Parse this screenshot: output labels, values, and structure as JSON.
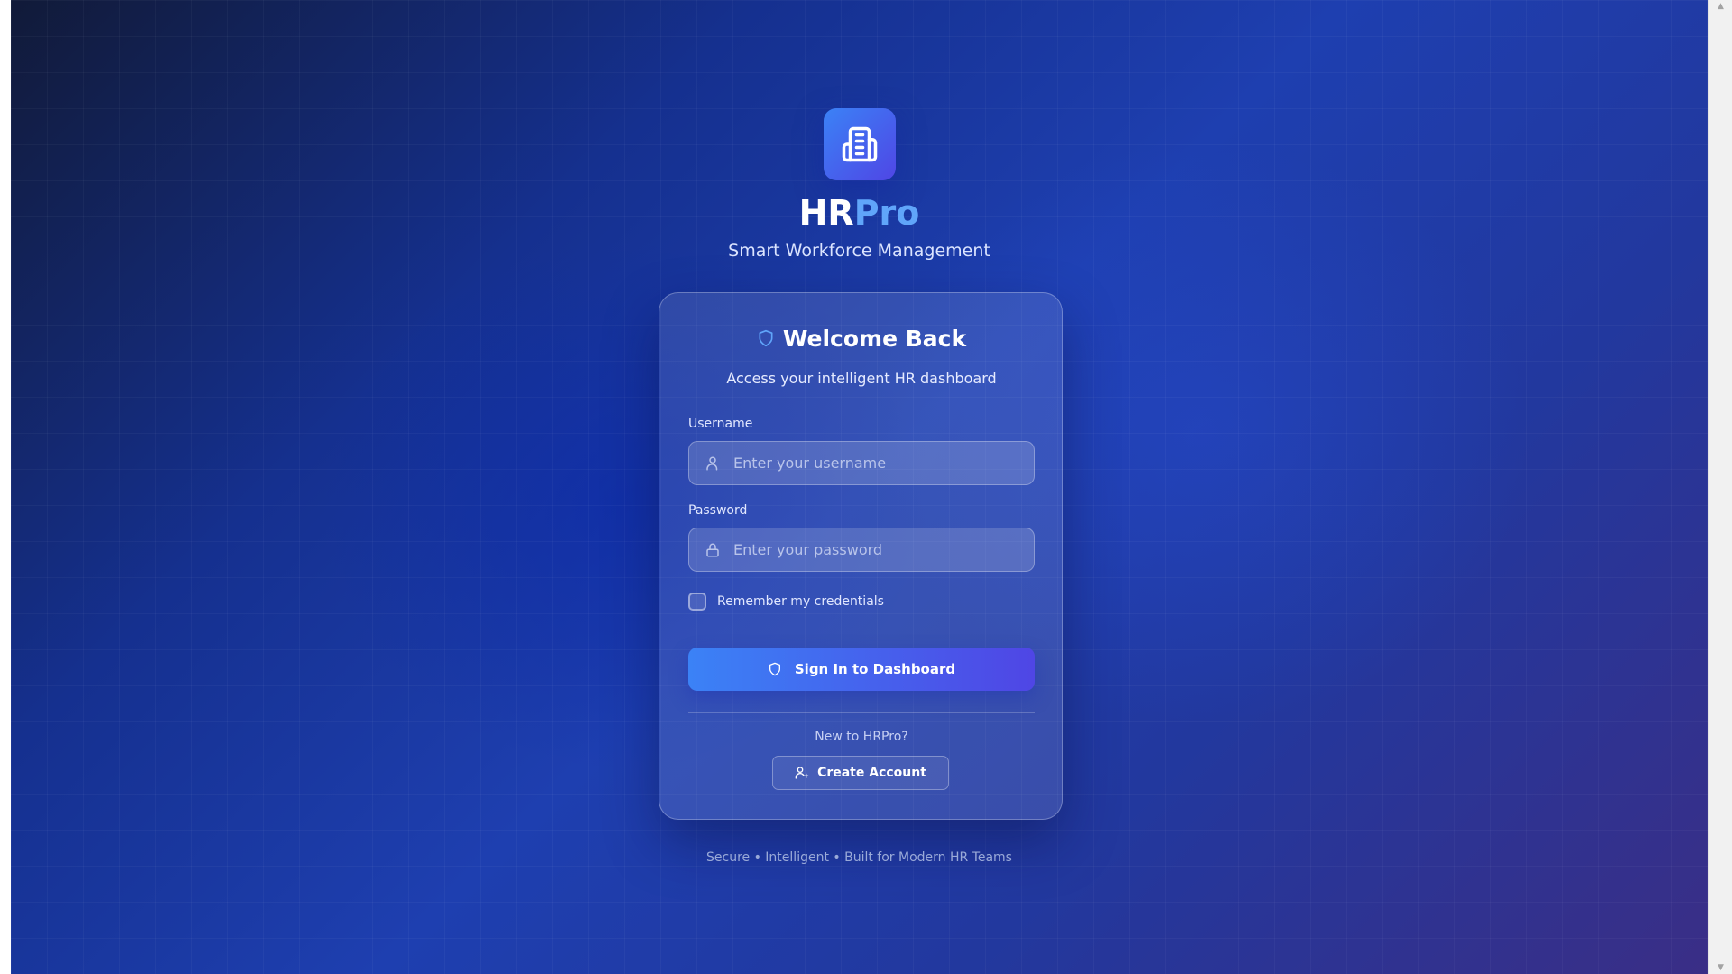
{
  "brand": {
    "name_part1": "HR",
    "name_part2": "Pro",
    "tagline": "Smart Workforce Management",
    "logo_icon": "building-icon"
  },
  "card": {
    "title": "Welcome Back",
    "title_icon": "shield-icon",
    "subtitle": "Access your intelligent HR dashboard",
    "username": {
      "label": "Username",
      "placeholder": "Enter your username",
      "value": "",
      "icon": "user-icon"
    },
    "password": {
      "label": "Password",
      "placeholder": "Enter your password",
      "value": "",
      "icon": "lock-icon"
    },
    "remember": {
      "label": "Remember my credentials",
      "checked": false
    },
    "signin_button": {
      "label": "Sign In to Dashboard",
      "icon": "shield-icon"
    },
    "new_prompt": "New to HRPro?",
    "create_button": {
      "label": "Create Account",
      "icon": "user-plus-icon"
    }
  },
  "footer": "Secure • Intelligent • Built for Modern HR Teams",
  "colors": {
    "accent": "#3b82f6",
    "accent_secondary": "#4f46e5",
    "brand_highlight": "#60a5fa",
    "background_dark": "#111a38",
    "background_blue": "#1e3fb0"
  }
}
